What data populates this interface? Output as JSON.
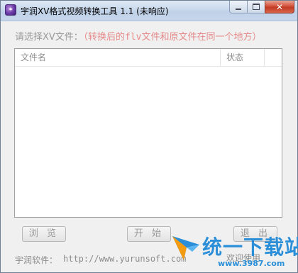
{
  "window": {
    "title": "宇润XV格式视频转换工具 1.1 (未响应)",
    "app_icon": "app-icon",
    "icon_glyph": "✶",
    "controls": {
      "minimize_icon": "minimize-icon",
      "maximize_icon": "maximize-icon",
      "close_icon": "close-icon",
      "close_glyph": "✕"
    }
  },
  "hint": {
    "label": "请选择XV文件：",
    "note": "（转换后的flv文件和原文件在同一个地方）"
  },
  "file_list": {
    "columns": [
      "文件名",
      "状态"
    ],
    "rows": []
  },
  "buttons": {
    "browse": "浏 览",
    "start": "开 始",
    "exit": "退 出"
  },
  "footer": {
    "label": "宇润软件：",
    "url": "http://www.yurunsoft.com",
    "welcome": "欢迎使用"
  },
  "watermark": {
    "text": "统一下载站",
    "sub": "www.3987.com"
  },
  "colors": {
    "hint_note": "#e58a8a",
    "disabled_text": "#9a9a9a",
    "watermark": "#2a8fd8",
    "close_button": "#c23a24"
  }
}
